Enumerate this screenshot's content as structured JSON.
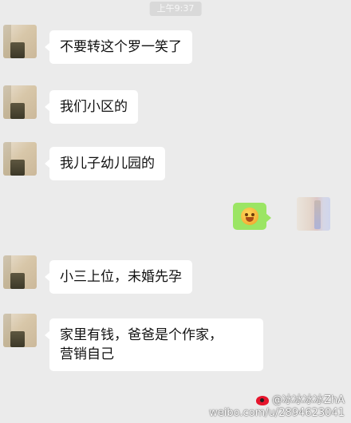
{
  "chat": {
    "timestamp": "上午9:37",
    "messages": [
      {
        "side": "left",
        "type": "text",
        "text": "不要转这个罗一笑了"
      },
      {
        "side": "left",
        "type": "text",
        "text": "我们小区的"
      },
      {
        "side": "left",
        "type": "text",
        "text": "我儿子幼儿园的"
      },
      {
        "side": "right",
        "type": "emoji",
        "emoji": "grin-emoji"
      },
      {
        "side": "left",
        "type": "text",
        "text": "小三上位，未婚先孕"
      },
      {
        "side": "left",
        "type": "text",
        "lines": [
          "家里有钱，爸爸是个作家，",
          "营销自己"
        ]
      }
    ]
  },
  "watermark": {
    "handle": "@冰冰冰冰ZhA",
    "url": "weibo.com/u/2894623041"
  },
  "colors": {
    "background": "#ebebeb",
    "received_bubble": "#ffffff",
    "sent_bubble": "#9be564"
  }
}
